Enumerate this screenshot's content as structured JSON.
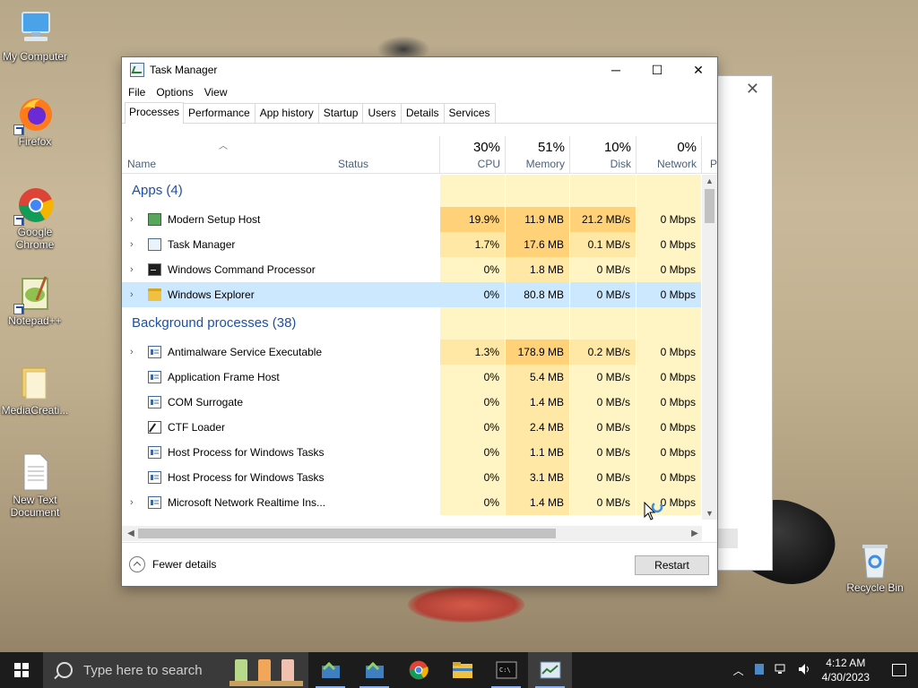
{
  "desktop": {
    "icons": [
      {
        "label": "My Computer"
      },
      {
        "label": "Firefox"
      },
      {
        "label": "Google Chrome"
      },
      {
        "label": "Notepad++"
      },
      {
        "label": "MediaCreati..."
      },
      {
        "label": "New Text Document"
      },
      {
        "label": "Recycle Bin"
      }
    ]
  },
  "task_manager": {
    "title": "Task Manager",
    "window_controls": {
      "minimize": "─",
      "maximize": "☐",
      "close": "✕"
    },
    "menu": [
      "File",
      "Options",
      "View"
    ],
    "tabs": [
      "Processes",
      "Performance",
      "App history",
      "Startup",
      "Users",
      "Details",
      "Services"
    ],
    "active_tab": "Processes",
    "columns": {
      "name": "Name",
      "status": "Status",
      "cpu": {
        "pct": "30%",
        "label": "CPU"
      },
      "memory": {
        "pct": "51%",
        "label": "Memory"
      },
      "disk": {
        "pct": "10%",
        "label": "Disk"
      },
      "network": {
        "pct": "0%",
        "label": "Network"
      },
      "power": "P"
    },
    "groups": {
      "apps": "Apps (4)",
      "background": "Background processes (38)"
    },
    "apps": [
      {
        "name": "Modern Setup Host",
        "cpu": "19.9%",
        "memory": "11.9 MB",
        "disk": "21.2 MB/s",
        "network": "0 Mbps",
        "icon": "setup-icon"
      },
      {
        "name": "Task Manager",
        "cpu": "1.7%",
        "memory": "17.6 MB",
        "disk": "0.1 MB/s",
        "network": "0 Mbps",
        "icon": "task-manager-icon"
      },
      {
        "name": "Windows Command Processor",
        "cpu": "0%",
        "memory": "1.8 MB",
        "disk": "0 MB/s",
        "network": "0 Mbps",
        "icon": "cmd-icon"
      },
      {
        "name": "Windows Explorer",
        "cpu": "0%",
        "memory": "80.8 MB",
        "disk": "0 MB/s",
        "network": "0 Mbps",
        "icon": "folder-icon"
      }
    ],
    "background": [
      {
        "name": "Antimalware Service Executable",
        "cpu": "1.3%",
        "memory": "178.9 MB",
        "disk": "0.2 MB/s",
        "network": "0 Mbps",
        "expandable": true
      },
      {
        "name": "Application Frame Host",
        "cpu": "0%",
        "memory": "5.4 MB",
        "disk": "0 MB/s",
        "network": "0 Mbps",
        "expandable": false
      },
      {
        "name": "COM Surrogate",
        "cpu": "0%",
        "memory": "1.4 MB",
        "disk": "0 MB/s",
        "network": "0 Mbps",
        "expandable": false
      },
      {
        "name": "CTF Loader",
        "cpu": "0%",
        "memory": "2.4 MB",
        "disk": "0 MB/s",
        "network": "0 Mbps",
        "expandable": false
      },
      {
        "name": "Host Process for Windows Tasks",
        "cpu": "0%",
        "memory": "1.1 MB",
        "disk": "0 MB/s",
        "network": "0 Mbps",
        "expandable": false
      },
      {
        "name": "Host Process for Windows Tasks",
        "cpu": "0%",
        "memory": "3.1 MB",
        "disk": "0 MB/s",
        "network": "0 Mbps",
        "expandable": false
      },
      {
        "name": "Microsoft Network Realtime Ins...",
        "cpu": "0%",
        "memory": "1.4 MB",
        "disk": "0 MB/s",
        "network": "0 Mbps",
        "expandable": true
      }
    ],
    "footer": {
      "fewer_details": "Fewer details",
      "restart": "Restart"
    },
    "colors": {
      "heat_light": "#fff4c4",
      "heat_mid": "#ffe8a6",
      "heat_high": "#ffd27a",
      "selected": "#cce8ff",
      "group": "#1e50a2"
    }
  },
  "taskbar": {
    "search_placeholder": "Type here to search",
    "pinned": [
      "setup-icon",
      "setup-icon-2",
      "chrome-icon",
      "file-explorer-icon",
      "cmd-icon",
      "task-manager-icon"
    ],
    "clock_time": "4:12 AM",
    "clock_date": "4/30/2023"
  }
}
